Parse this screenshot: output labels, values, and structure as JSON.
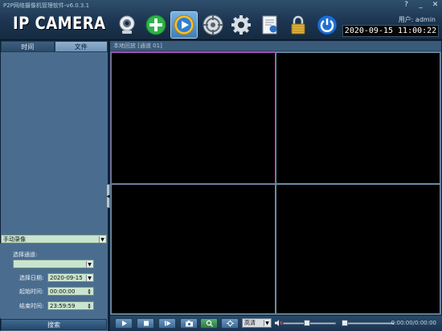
{
  "window": {
    "title": "P2P网络摄像机管理软件-v6.0.3.1",
    "controls": [
      "?",
      "_",
      "✕"
    ]
  },
  "header": {
    "logo": "IP CAMERA",
    "user_label": "用户: admin",
    "clock": "2020-09-15  11:00:22",
    "toolbar_icons": [
      "camera-icon",
      "add-device-icon",
      "playback-icon",
      "ptz-control-icon",
      "settings-icon",
      "log-document-icon",
      "lock-icon",
      "power-icon"
    ],
    "active_tool": "playback-icon"
  },
  "left_panel": {
    "tabs": [
      {
        "label": "时间",
        "active": false
      },
      {
        "label": "文件",
        "active": true
      }
    ],
    "record_type": "手动录像",
    "channel_label": "选择通道:",
    "channel_value": "",
    "date_label": "选择日期:",
    "date_value": "2020-09-15",
    "start_label": "起始时间:",
    "start_value": "00:00:00",
    "end_label": "结束时间:",
    "end_value": "23:59:59",
    "search_button": "搜索"
  },
  "video": {
    "header": "本地回放 [通道 01]",
    "cells": 4,
    "selected_cell": 0
  },
  "playbar": {
    "quality": "高清",
    "time": "0:00:00/0:00:00",
    "volume_level": 0.45,
    "progress": 0.0
  },
  "colors": {
    "accent": "#6f93b6",
    "panel_bg": "#4a6d8f",
    "field_bg": "#c9e4cf",
    "selected_border": "#c040c0"
  }
}
